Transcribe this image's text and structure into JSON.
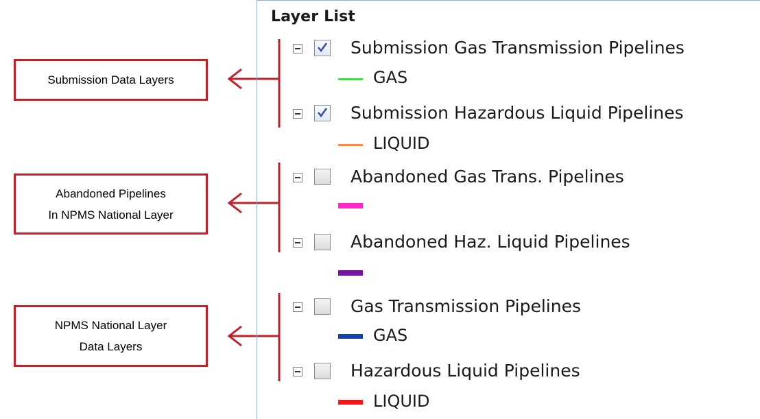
{
  "panel": {
    "title": "Layer List",
    "layers": [
      {
        "label": "Submission Gas Transmission Pipelines",
        "checked": true,
        "legend": {
          "label": "GAS",
          "color": "#40e040"
        }
      },
      {
        "label": "Submission Hazardous Liquid Pipelines",
        "checked": true,
        "legend": {
          "label": "LIQUID",
          "color": "#ff8533"
        }
      },
      {
        "label": "Abandoned Gas Trans. Pipelines",
        "checked": false,
        "legend": {
          "label": "",
          "color": "#ff29c9"
        }
      },
      {
        "label": "Abandoned Haz. Liquid Pipelines",
        "checked": false,
        "legend": {
          "label": "",
          "color": "#7b12a8"
        }
      },
      {
        "label": "Gas Transmission Pipelines",
        "checked": false,
        "legend": {
          "label": "GAS",
          "color": "#1740a8"
        }
      },
      {
        "label": "Hazardous Liquid Pipelines",
        "checked": false,
        "legend": {
          "label": "LIQUID",
          "color": "#ff1212"
        }
      }
    ]
  },
  "annotations": [
    {
      "text": "Submission Data Layers"
    },
    {
      "text": "Abandoned Pipelines\nIn NPMS National Layer"
    },
    {
      "text": "NPMS National Layer\nData Layers"
    }
  ],
  "colors": {
    "annotation": "#c0222b",
    "panel_border": "#8fb0d6"
  }
}
